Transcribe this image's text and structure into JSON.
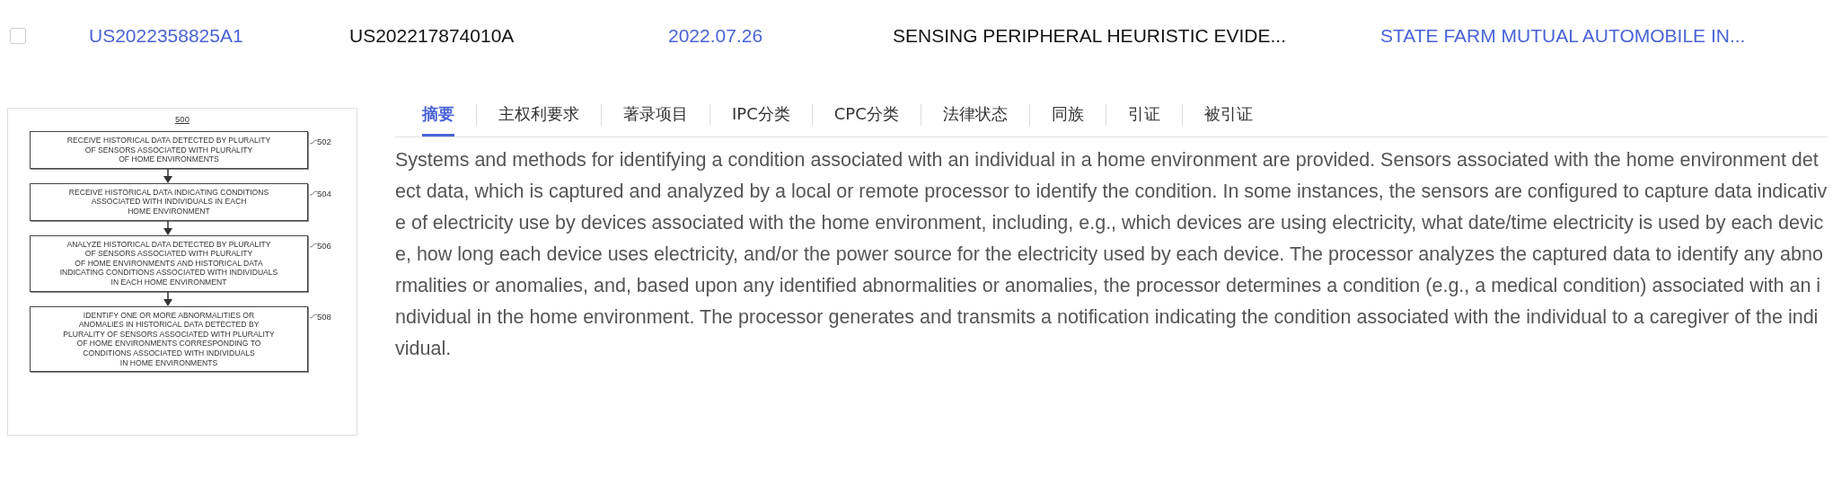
{
  "row": {
    "checked": false,
    "publication_number": "US2022358825A1",
    "application_number": "US202217874010A",
    "date": "2022.07.26",
    "title": "SENSING PERIPHERAL HEURISTIC EVIDE...",
    "assignee": "STATE FARM MUTUAL AUTOMOBILE IN..."
  },
  "drawing": {
    "figure_number": "500",
    "steps": [
      {
        "text": "RECEIVE HISTORICAL DATA DETECTED BY PLURALITY\nOF SENSORS ASSOCIATED WITH PLURALITY\nOF HOME ENVIRONMENTS",
        "ref": "502"
      },
      {
        "text": "RECEIVE HISTORICAL DATA INDICATING CONDITIONS\nASSOCIATED WITH INDIVIDUALS IN EACH\nHOME ENVIRONMENT",
        "ref": "504"
      },
      {
        "text": "ANALYZE HISTORICAL DATA DETECTED BY PLURALITY\nOF SENSORS ASSOCIATED WITH PLURALITY\nOF HOME ENVIRONMENTS AND HISTORICAL DATA\nINDICATING CONDITIONS ASSOCIATED WITH INDIVIDUALS\nIN EACH HOME ENVIRONMENT",
        "ref": "506"
      },
      {
        "text": "IDENTIFY ONE OR MORE ABNORMALITIES OR\nANOMALIES IN HISTORICAL DATA DETECTED BY\nPLURALITY OF SENSORS ASSOCIATED WITH PLURALITY\nOF HOME ENVIRONMENTS CORRESPONDING TO\nCONDITIONS ASSOCIATED WITH INDIVIDUALS\nIN HOME ENVIRONMENTS",
        "ref": "508"
      }
    ]
  },
  "tabs": [
    {
      "label": "摘要",
      "selected": true
    },
    {
      "label": "主权利要求",
      "selected": false
    },
    {
      "label": "著录项目",
      "selected": false
    },
    {
      "label": "IPC分类",
      "selected": false
    },
    {
      "label": "CPC分类",
      "selected": false
    },
    {
      "label": "法律状态",
      "selected": false
    },
    {
      "label": "同族",
      "selected": false
    },
    {
      "label": "引证",
      "selected": false
    },
    {
      "label": "被引证",
      "selected": false
    }
  ],
  "abstract": "Systems and methods for identifying a condition associated with an individual in a home environment are provided. Sensors associated with the home environment detect data, which is captured and analyzed by a local or remote processor to identify the condition. In some instances, the sensors are configured to capture data indicative of electricity use by devices associated with the home environment, including, e.g., which devices are using electricity, what date/time electricity is used by each device, how long each device uses electricity, and/or the power source for the electricity used by each device. The processor analyzes the captured data to identify any abnormalities or anomalies, and, based upon any identified abnormalities or anomalies, the processor determines a condition (e.g., a medical condition) associated with an individual in the home environment. The processor generates and transmits a notification indicating the condition associated with the individual to a caregiver of the individual."
}
